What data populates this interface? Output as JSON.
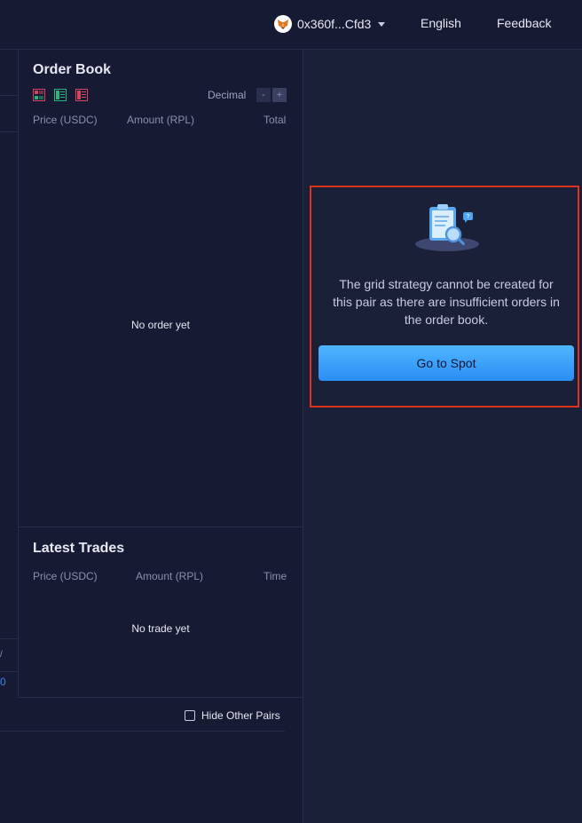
{
  "header": {
    "wallet_address": "0x360f...Cfd3",
    "language": "English",
    "feedback": "Feedback"
  },
  "order_book": {
    "title": "Order Book",
    "decimal_label": "Decimal",
    "decimal_minus": "-",
    "decimal_plus": "+",
    "columns": [
      "Price (USDC)",
      "Amount (RPL)",
      "Total"
    ],
    "empty_text": "No order yet"
  },
  "latest_trades": {
    "title": "Latest Trades",
    "columns": [
      "Price (USDC)",
      "Amount (RPL)",
      "Time"
    ],
    "empty_text": "No trade yet"
  },
  "positions": {
    "hide_other_pairs": "Hide Other Pairs"
  },
  "left_strip": {
    "tick": "/",
    "link": "0"
  },
  "grid_notice": {
    "message": "The grid strategy cannot be created for this pair as there are insufficient orders in the order book.",
    "button_label": "Go to Spot"
  },
  "colors": {
    "background": "#161a33",
    "panel": "#1b2039",
    "accent": "#2a8ef5",
    "highlight_border": "#e0301e"
  }
}
